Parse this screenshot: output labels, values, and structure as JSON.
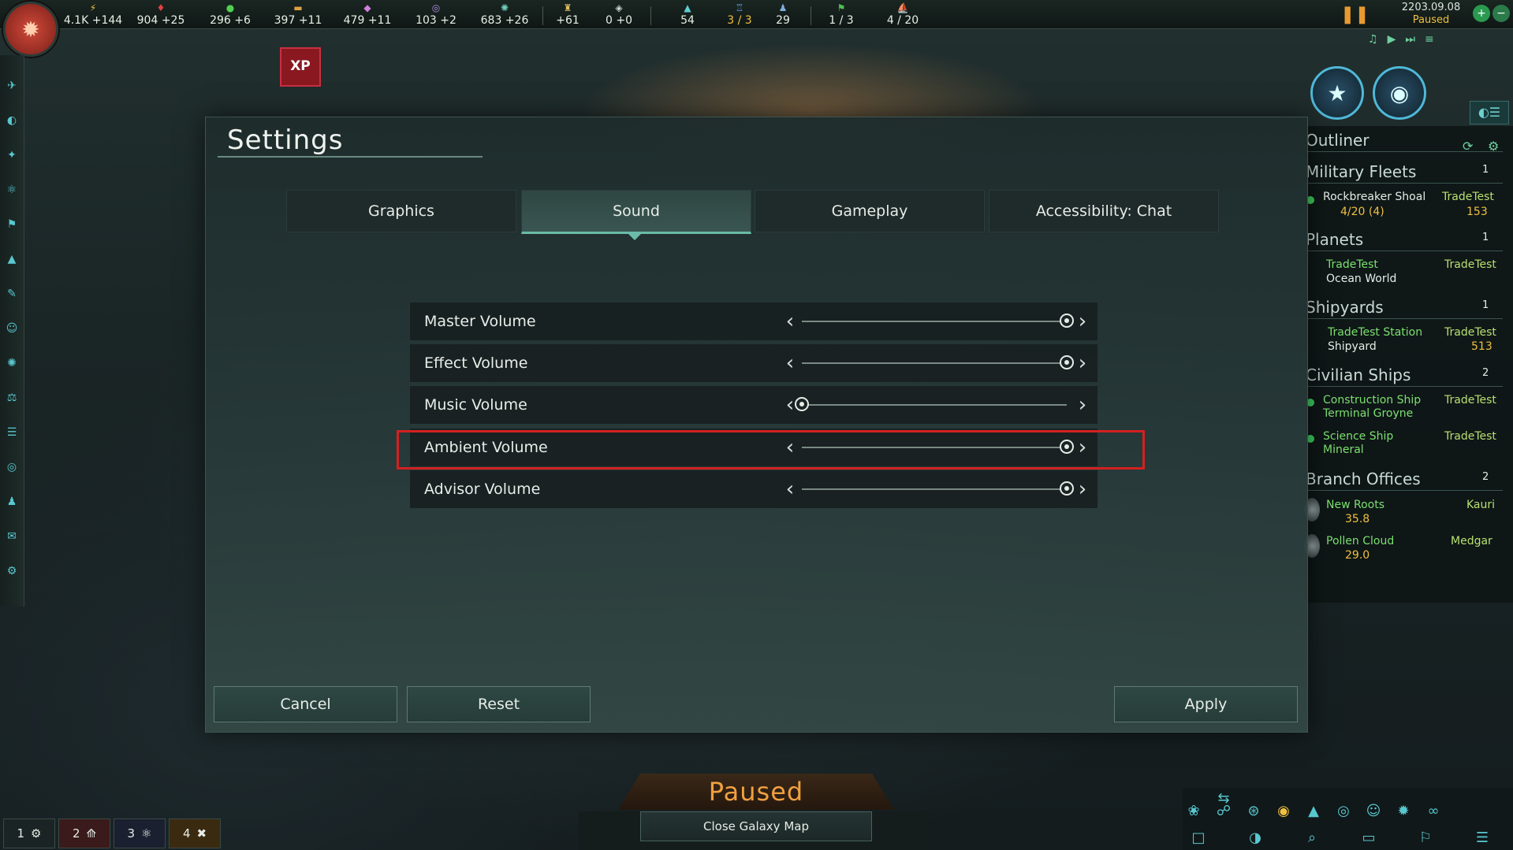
{
  "topbar": {
    "resources": [
      {
        "icon": "energy-icon",
        "glyph": "⚡",
        "value": "4.1K +144"
      },
      {
        "icon": "minerals-icon",
        "glyph": "♦",
        "value": "904 +25"
      },
      {
        "icon": "food-icon",
        "glyph": "●",
        "value": "296 +6"
      },
      {
        "icon": "consumer-goods-icon",
        "glyph": "▬",
        "value": "397 +11"
      },
      {
        "icon": "alloys-icon",
        "glyph": "◆",
        "value": "479 +11"
      },
      {
        "icon": "influence-icon",
        "glyph": "◎",
        "value": "103 +2"
      },
      {
        "icon": "unity-icon",
        "glyph": "✺",
        "value": "683 +26"
      },
      {
        "icon": "amenities-icon",
        "glyph": "♜",
        "value": "+61"
      },
      {
        "icon": "trade-icon",
        "glyph": "◈",
        "value": "0 +0"
      },
      {
        "icon": "fleet-icon",
        "glyph": "▲",
        "value": "54"
      },
      {
        "icon": "starbase-icon",
        "glyph": "♖",
        "value": "3 / 3"
      },
      {
        "icon": "pops-icon",
        "glyph": "♟",
        "value": "29"
      },
      {
        "icon": "envoys-icon",
        "glyph": "⚑",
        "value": "1 / 3"
      },
      {
        "icon": "naval-cap-icon",
        "glyph": "⛵",
        "value": "4 / 20"
      }
    ],
    "date": "2203.09.08",
    "status": "Paused"
  },
  "xp_badge": "XP",
  "settings": {
    "title": "Settings",
    "tabs": [
      "Graphics",
      "Sound",
      "Gameplay",
      "Accessibility: Chat"
    ],
    "active_tab": "Sound",
    "volumes": [
      {
        "label": "Master Volume",
        "level": 1.0
      },
      {
        "label": "Effect Volume",
        "level": 1.0
      },
      {
        "label": "Music Volume",
        "level": 0.0
      },
      {
        "label": "Ambient Volume",
        "level": 1.0
      },
      {
        "label": "Advisor Volume",
        "level": 1.0
      }
    ],
    "buttons": {
      "cancel": "Cancel",
      "reset": "Reset",
      "apply": "Apply"
    }
  },
  "outliner": {
    "title": "Outliner",
    "sections": {
      "military_fleets": {
        "title": "Military Fleets",
        "count": "1"
      },
      "planets": {
        "title": "Planets",
        "count": "1"
      },
      "shipyards": {
        "title": "Shipyards",
        "count": "1"
      },
      "civilian_ships": {
        "title": "Civilian Ships",
        "count": "2"
      },
      "branch_offices": {
        "title": "Branch Offices",
        "count": "2"
      }
    },
    "fleet": {
      "name": "Rockbreaker Shoal",
      "owner": "TradeTest",
      "strength": "4/20 (4)",
      "power": "153"
    },
    "planet": {
      "name": "TradeTest",
      "type": "Ocean World",
      "owner": "TradeTest"
    },
    "shipyard": {
      "name": "TradeTest Station",
      "type": "Shipyard",
      "owner": "TradeTest",
      "power": "513"
    },
    "ships": [
      {
        "name": "Construction Ship",
        "status": "Terminal Groyne",
        "owner": "TradeTest"
      },
      {
        "name": "Science Ship",
        "status": "Mineral",
        "owner": "TradeTest"
      }
    ],
    "branches": [
      {
        "name": "New Roots",
        "value": "35.8",
        "owner": "Kauri"
      },
      {
        "name": "Pollen Cloud",
        "value": "29.0",
        "owner": "Medgar"
      }
    ]
  },
  "bottom": {
    "paused_label": "Paused",
    "close_map": "Close Galaxy Map",
    "groups": [
      "1",
      "2",
      "3",
      "4"
    ]
  }
}
